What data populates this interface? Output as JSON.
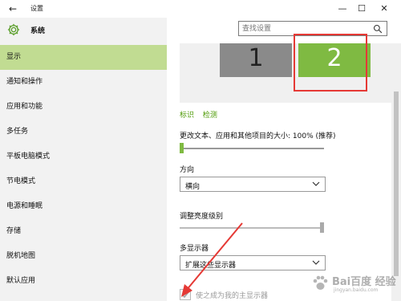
{
  "window": {
    "title": "设置",
    "back_glyph": "←",
    "min_glyph": "—",
    "max_glyph": "☐",
    "close_glyph": "✕"
  },
  "sidebar": {
    "title": "系统",
    "items": [
      {
        "label": "显示",
        "active": true
      },
      {
        "label": "通知和操作"
      },
      {
        "label": "应用和功能"
      },
      {
        "label": "多任务"
      },
      {
        "label": "平板电脑模式"
      },
      {
        "label": "节电模式"
      },
      {
        "label": "电源和睡眠"
      },
      {
        "label": "存储"
      },
      {
        "label": "脱机地图"
      },
      {
        "label": "默认应用"
      }
    ]
  },
  "search": {
    "placeholder": "查找设置"
  },
  "display": {
    "monitors": [
      "1",
      "2"
    ],
    "identify_link": "标识",
    "detect_link": "检测",
    "scale_label": "更改文本、应用和其他项目的大小: 100% (推荐)",
    "scale_level": 0.0,
    "orientation_label": "方向",
    "orientation_value": "横向",
    "brightness_label": "调整亮度级别",
    "brightness_level": 1.0,
    "multi_display_label": "多显示器",
    "multi_display_value": "扩展这些显示器",
    "main_display_label": "使之成为我的主显示器",
    "main_display_checked": true
  },
  "colors": {
    "accent": "#7fba42",
    "active_nav": "#c1dc92",
    "annotation": "#e53935"
  },
  "watermark": {
    "text": "Bai百度 经验",
    "url": "jingyan.baidu.com"
  }
}
